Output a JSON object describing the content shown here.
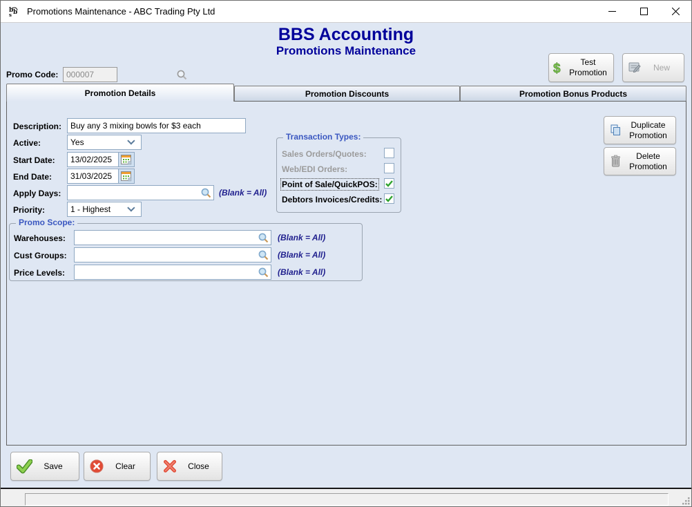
{
  "window": {
    "title": "Promotions Maintenance - ABC Trading Pty Ltd"
  },
  "header": {
    "app_title": "BBS Accounting",
    "screen_title": "Promotions Maintenance"
  },
  "toolbar": {
    "promo_code": {
      "label": "Promo Code:",
      "value": "000007"
    },
    "test_promotion_button": "Test Promotion",
    "new_button": "New"
  },
  "tabs": [
    {
      "label": "Promotion Details",
      "active": true
    },
    {
      "label": "Promotion Discounts",
      "active": false
    },
    {
      "label": "Promotion Bonus Products",
      "active": false
    }
  ],
  "form": {
    "description": {
      "label": "Description:",
      "value": "Buy any 3 mixing bowls for $3 each"
    },
    "active": {
      "label": "Active:",
      "value": "Yes"
    },
    "start_date": {
      "label": "Start Date:",
      "value": "13/02/2025"
    },
    "end_date": {
      "label": "End Date:",
      "value": "31/03/2025"
    },
    "apply_days": {
      "label": "Apply Days:",
      "value": "",
      "hint": "(Blank = All)"
    },
    "priority": {
      "label": "Priority:",
      "value": "1 - Highest"
    }
  },
  "transaction_types": {
    "legend": "Transaction Types:",
    "items": [
      {
        "label": "Sales Orders/Quotes:",
        "checked": false,
        "enabled": false
      },
      {
        "label": "Web/EDI Orders:",
        "checked": false,
        "enabled": false
      },
      {
        "label": "Point of Sale/QuickPOS:",
        "checked": true,
        "enabled": true,
        "focused": true
      },
      {
        "label": "Debtors Invoices/Credits:",
        "checked": true,
        "enabled": true
      }
    ]
  },
  "promo_scope": {
    "legend": "Promo Scope:",
    "rows": [
      {
        "label": "Warehouses:",
        "value": "",
        "hint": "(Blank = All)"
      },
      {
        "label": "Cust Groups:",
        "value": "",
        "hint": "(Blank = All)"
      },
      {
        "label": "Price Levels:",
        "value": "",
        "hint": "(Blank = All)"
      }
    ]
  },
  "side_buttons": {
    "duplicate": "Duplicate Promotion",
    "delete": "Delete Promotion"
  },
  "footer_buttons": {
    "save": "Save",
    "clear": "Clear",
    "close": "Close"
  },
  "colors": {
    "background": "#dfe7f3",
    "header_text": "#00009a",
    "legend_text": "#3a57c0",
    "hint_text": "#20208e",
    "check_green": "#2fa22f",
    "disabled_text": "#9b9b9b",
    "field_border": "#8fa8c2"
  }
}
